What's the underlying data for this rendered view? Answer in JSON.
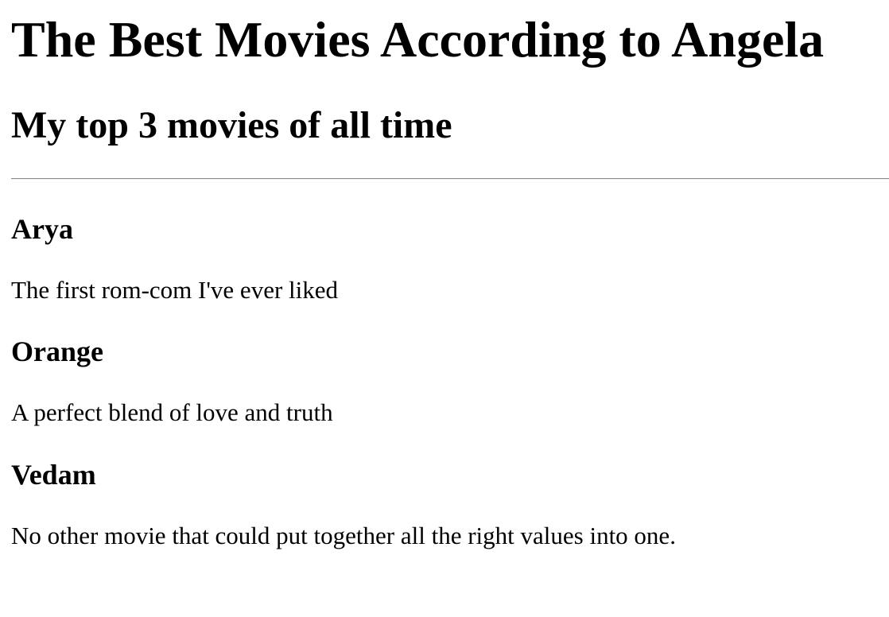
{
  "page": {
    "title": "The Best Movies According to Angela",
    "subtitle": "My top 3 movies of all time"
  },
  "movies": [
    {
      "title": "Arya",
      "description": "The first rom-com I've ever liked"
    },
    {
      "title": "Orange",
      "description": "A perfect blend of love and truth"
    },
    {
      "title": "Vedam",
      "description": "No other movie that could put together all the right values into one."
    }
  ]
}
